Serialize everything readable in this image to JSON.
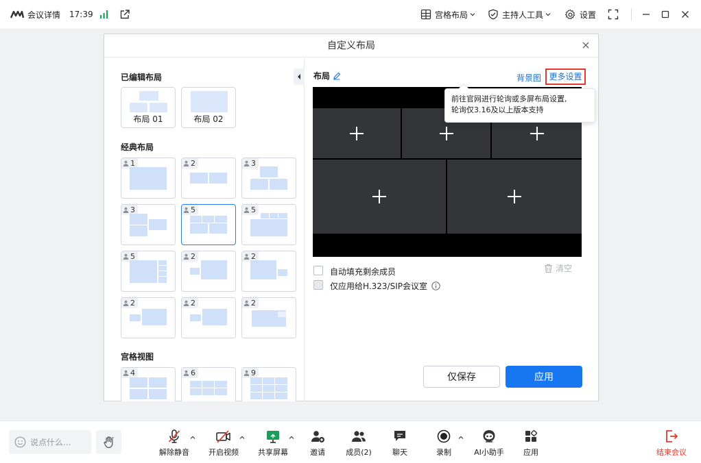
{
  "topbar": {
    "meeting_details": "会议详情",
    "time": "17:39",
    "grid_layout": "宫格布局",
    "host_tools": "主持人工具",
    "settings": "设置"
  },
  "dialog": {
    "title": "自定义布局",
    "left": {
      "edited_title": "已编辑布局",
      "edited_layouts": [
        {
          "label": "布局 01"
        },
        {
          "label": "布局 02"
        }
      ],
      "classic_title": "经典布局",
      "classic_counts": [
        "1",
        "2",
        "3",
        "3",
        "5",
        "5",
        "5",
        "2",
        "2",
        "2",
        "2",
        "2"
      ],
      "grid_title": "宫格视图",
      "grid_counts": [
        "4",
        "6",
        "9"
      ]
    },
    "right": {
      "layout_title": "布局",
      "background_link": "背景图",
      "more_settings_link": "更多设置",
      "tooltip": [
        "前往官网进行轮询或多屏布局设置,",
        "轮询仅3.16及以上版本支持"
      ],
      "checkbox_autofill": "自动填充剩余成员",
      "checkbox_h323": "仅应用给H.323/SIP会议室",
      "clear": "清空",
      "save_button": "仅保存",
      "apply_button": "应用"
    }
  },
  "bottombar": {
    "chat_placeholder": "说点什么...",
    "unmute": "解除静音",
    "start_video": "开启视频",
    "share_screen": "共享屏幕",
    "invite": "邀请",
    "members": "成员(2)",
    "chat": "聊天",
    "record": "录制",
    "ai_assistant": "AI小助手",
    "apps": "应用",
    "end_meeting": "结束会议"
  },
  "colors": {
    "accent": "#1677f0",
    "danger": "#e23b2e",
    "signal": "#18a058"
  }
}
